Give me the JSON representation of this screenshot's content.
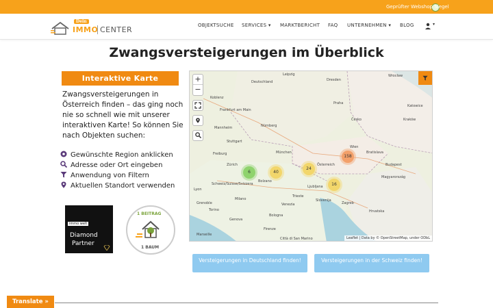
{
  "topbar": {
    "seal_text": "Geprüfter Webshop Siegel"
  },
  "header": {
    "logo": {
      "tag": "Dein",
      "word1": "IMMO",
      "word2": "CENTER"
    },
    "nav": [
      {
        "label": "OBJEKTSUCHE",
        "caret": ""
      },
      {
        "label": "SERVICES",
        "caret": "▾"
      },
      {
        "label": "MARKTBERICHT",
        "caret": ""
      },
      {
        "label": "FAQ",
        "caret": ""
      },
      {
        "label": "UNTERNEHMEN",
        "caret": "▾"
      },
      {
        "label": "BLOG",
        "caret": ""
      }
    ],
    "user_icon": "user-icon"
  },
  "page": {
    "title": "Zwangsversteigerungen im Überblick"
  },
  "sidebar": {
    "heading": "Interaktive Karte",
    "intro": "Zwangsversteigerungen in Österreich finden – das ging noch nie so schnell wie mit unserer interaktiven Karte! So können Sie nach Objekten suchen:",
    "features": [
      {
        "icon": "target-icon",
        "label": "Gewünschte Region anklicken"
      },
      {
        "icon": "search-icon",
        "label": "Adresse oder Ort eingeben"
      },
      {
        "icon": "filter-icon",
        "label": "Anwendung von Filtern"
      },
      {
        "icon": "location-pin-icon",
        "label": "Aktuellen Standort verwenden"
      }
    ],
    "badge_diamond": {
      "brand": "immo welt",
      "line1": "Diamond",
      "line2": "Partner"
    },
    "badge_tree": {
      "line1": "1 BEITRAG",
      "line2": "1 BAUM"
    }
  },
  "map": {
    "zoom_in": "+",
    "zoom_out": "−",
    "clusters": [
      {
        "count": "6",
        "color": "#8fd36d"
      },
      {
        "count": "40",
        "color": "#f2d66b"
      },
      {
        "count": "24",
        "color": "#f2d66b"
      },
      {
        "count": "158",
        "color": "#f3a06a"
      },
      {
        "count": "16",
        "color": "#f2d66b"
      }
    ],
    "cities": [
      "Leipzig",
      "Dresden",
      "Wrocław",
      "Kraków",
      "Katowice",
      "Deutschland",
      "Praha",
      "Česko",
      "Frankfurt am Main",
      "Nürnberg",
      "Stuttgart",
      "München",
      "Wien",
      "Bratislava",
      "Österreich",
      "Budapest",
      "Magyarország",
      "Zürich",
      "Schweiz/Suisse/Svizzera",
      "Slovenija",
      "Zagreb",
      "Hrvatska",
      "Milano",
      "Venezia",
      "Torino",
      "Genova",
      "Bologna",
      "Firenze",
      "Città di San Marino",
      "Lyon",
      "Grenoble",
      "Marseille",
      "Koblenz",
      "Mannheim",
      "Freiburg",
      "Ljubljana",
      "Trieste",
      "Bolzano"
    ],
    "attribution": "Leaflet | Data by © OpenStreetMap, under ODbL"
  },
  "buttons": {
    "de": "Versteigerungen in Deutschland finden!",
    "ch": "Versteigerungen in der Schweiz finden!"
  },
  "translate": {
    "label": "Translate »"
  }
}
